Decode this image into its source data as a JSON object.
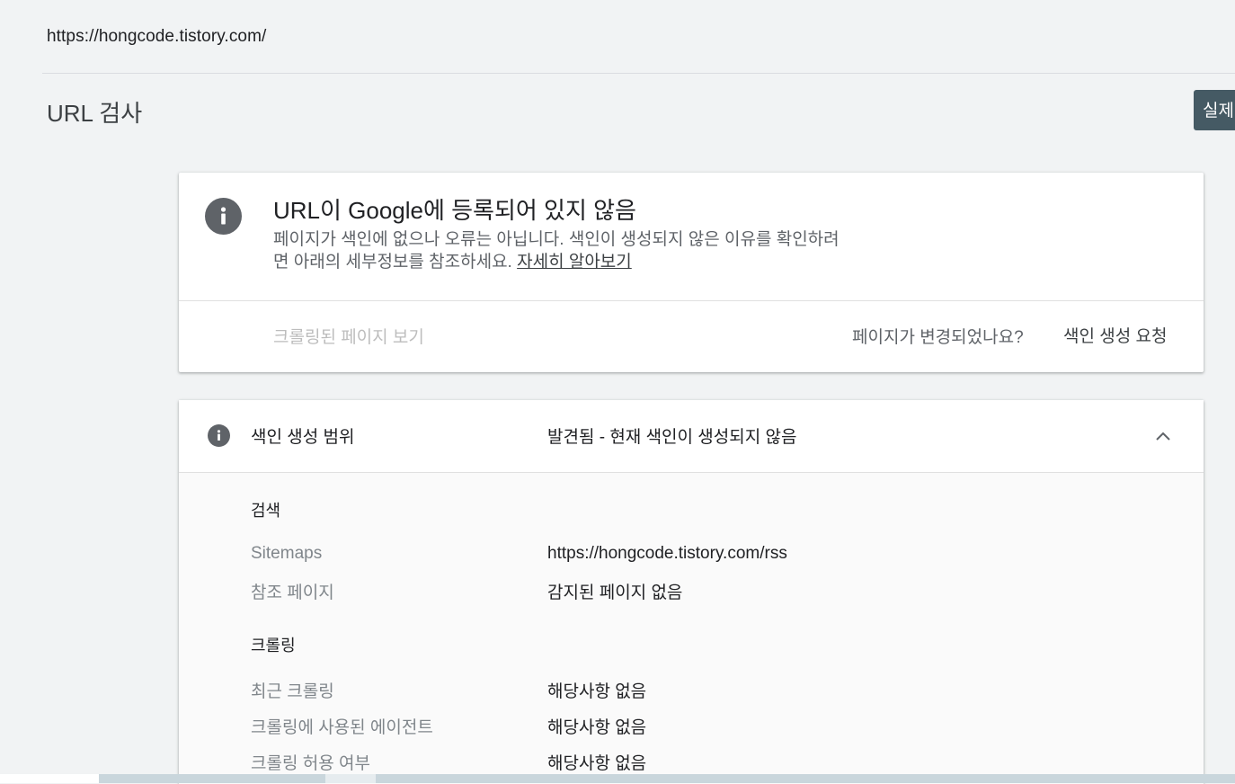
{
  "header": {
    "property_url": "https://hongcode.tistory.com/",
    "page_title": "URL 검사",
    "live_test_label": "실제 URL 테스트"
  },
  "status_card": {
    "icon": "info-icon",
    "title": "URL이 Google에 등록되어 있지 않음",
    "description_line1": "페이지가 색인에 없으나 오류는 아닙니다. 색인이 생성되지 않은 이유를 확인하려",
    "description_line2": "면 아래의 세부정보를 참조하세요.",
    "learn_more": "자세히 알아보기",
    "view_crawled_page": "크롤링된 페이지 보기",
    "page_changed": "페이지가 변경되었나요?",
    "request_indexing": "색인 생성 요청"
  },
  "coverage": {
    "icon": "info-icon",
    "label": "색인 생성 범위",
    "value": "발견됨 - 현재 색인이 생성되지 않음",
    "expanded": true,
    "sections": [
      {
        "heading": "검색",
        "rows": [
          {
            "label": "Sitemaps",
            "value": "https://hongcode.tistory.com/rss"
          },
          {
            "label": "참조 페이지",
            "value": "감지된 페이지 없음"
          }
        ]
      },
      {
        "heading": "크롤링",
        "rows": [
          {
            "label": "최근 크롤링",
            "value": "해당사항 없음"
          },
          {
            "label": "크롤링에 사용된 에이전트",
            "value": "해당사항 없음"
          },
          {
            "label": "크롤링 허용 여부",
            "value": "해당사항 없음"
          }
        ]
      }
    ]
  },
  "colors": {
    "page_background": "#f1f3f4",
    "live_test_button": "#455a64",
    "icon_grey": "#5f6368",
    "muted_text": "#80868b",
    "disabled_text": "#bdbdbd"
  }
}
